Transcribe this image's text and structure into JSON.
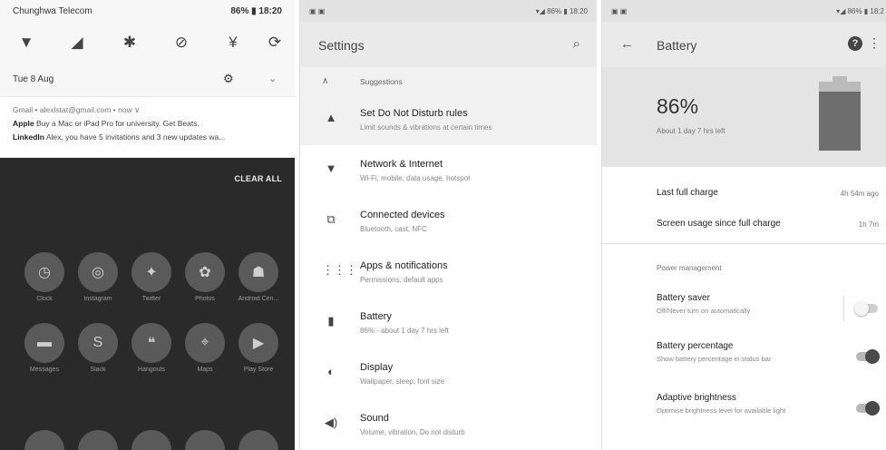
{
  "notification_shade": {
    "carrier": "Chunghwa Telecom",
    "status_right": "86% ▮ 18:20",
    "quick_settings": [
      "wifi-icon",
      "signal-icon",
      "bluetooth-icon",
      "dnd-icon",
      "flashlight-icon",
      "rotate-icon"
    ],
    "date": "Tue 8 Aug",
    "notification": {
      "header": "Gmail • alexlstat@gmail.com • now ∨",
      "line1_sender": "Apple",
      "line1_text": "Buy a Mac or iPad Pro for university. Get Beats.",
      "line2_sender": "LinkedIn",
      "line2_text": "Alex, you have 5 invitations and 3 new updates wa..."
    },
    "clear_all": "CLEAR ALL",
    "apps": [
      {
        "label": "Clock",
        "icon": "clock-icon"
      },
      {
        "label": "Instagram",
        "icon": "instagram-icon"
      },
      {
        "label": "Twitter",
        "icon": "twitter-icon"
      },
      {
        "label": "Photos",
        "icon": "photos-icon"
      },
      {
        "label": "Android Cen...",
        "icon": "android-icon"
      },
      {
        "label": "Messages",
        "icon": "messages-icon"
      },
      {
        "label": "Slack",
        "icon": "slack-icon"
      },
      {
        "label": "Hangouts",
        "icon": "hangouts-icon"
      },
      {
        "label": "Maps",
        "icon": "maps-icon"
      },
      {
        "label": "Play Store",
        "icon": "play-store-icon"
      }
    ]
  },
  "settings": {
    "status_left": "▣ ▣",
    "status_right": "▾◢ 86% ▮ 18:20",
    "title": "Settings",
    "suggestions_label": "Suggestions",
    "items": [
      {
        "icon": "dnd-bell-icon",
        "title": "Set Do Not Disturb rules",
        "subtitle": "Limit sounds & vibrations at certain times"
      },
      {
        "icon": "wifi-icon",
        "title": "Network & Internet",
        "subtitle": "Wi-Fi, mobile, data usage, hotspot"
      },
      {
        "icon": "devices-icon",
        "title": "Connected devices",
        "subtitle": "Bluetooth, cast, NFC"
      },
      {
        "icon": "apps-grid-icon",
        "title": "Apps & notifications",
        "subtitle": "Permissions, default apps"
      },
      {
        "icon": "battery-icon",
        "title": "Battery",
        "subtitle": "86% - about 1 day 7 hrs left"
      },
      {
        "icon": "display-icon",
        "title": "Display",
        "subtitle": "Wallpaper, sleep, font size"
      },
      {
        "icon": "sound-icon",
        "title": "Sound",
        "subtitle": "Volume, vibration, Do not disturb"
      }
    ]
  },
  "battery": {
    "status_left": "▣ ▣",
    "status_right": "▾◢ 86% ▮ 18:2",
    "title": "Battery",
    "percent": "86%",
    "level": 0.86,
    "time_left": "About 1 day 7 hrs left",
    "rows": [
      {
        "label": "Last full charge",
        "value": "4h 54m ago"
      },
      {
        "label": "Screen usage since full charge",
        "value": "1h 7m"
      }
    ],
    "section": "Power management",
    "toggles": [
      {
        "title": "Battery saver",
        "subtitle": "Off/Never turn on automatically",
        "on": false
      },
      {
        "title": "Battery percentage",
        "subtitle": "Show battery percentage in status bar",
        "on": true
      },
      {
        "title": "Adaptive brightness",
        "subtitle": "Optimise brightness level for available light",
        "on": true
      }
    ]
  }
}
